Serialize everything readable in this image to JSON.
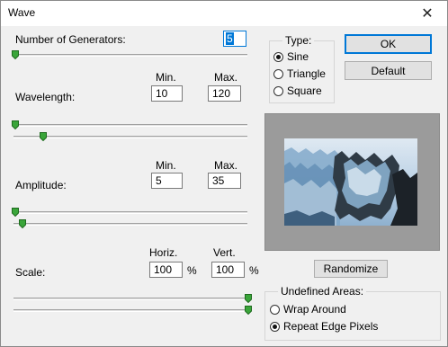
{
  "window": {
    "title": "Wave"
  },
  "generators": {
    "label": "Number of Generators:",
    "value": "5"
  },
  "wavelength": {
    "label": "Wavelength:",
    "min_header": "Min.",
    "max_header": "Max.",
    "min": "10",
    "max": "120"
  },
  "amplitude": {
    "label": "Amplitude:",
    "min_header": "Min.",
    "max_header": "Max.",
    "min": "5",
    "max": "35"
  },
  "scale": {
    "label": "Scale:",
    "horiz_header": "Horiz.",
    "vert_header": "Vert.",
    "horiz": "100",
    "vert": "100",
    "unit": "%"
  },
  "type_group": {
    "title": "Type:",
    "options": [
      {
        "label": "Sine",
        "selected": true
      },
      {
        "label": "Triangle",
        "selected": false
      },
      {
        "label": "Square",
        "selected": false
      }
    ]
  },
  "buttons": {
    "ok": "OK",
    "default": "Default",
    "randomize": "Randomize"
  },
  "undefined_areas": {
    "title": "Undefined Areas:",
    "options": [
      {
        "label": "Wrap Around",
        "selected": false
      },
      {
        "label": "Repeat Edge Pixels",
        "selected": true
      }
    ]
  },
  "colors": {
    "accent": "#0078d7",
    "thumb": "#3aa53a"
  }
}
